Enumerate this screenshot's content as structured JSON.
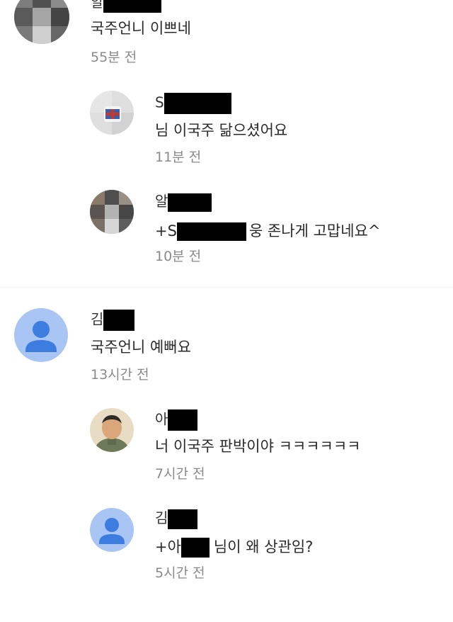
{
  "comments": [
    {
      "author_prefix": "알",
      "text": "국주언니 이쁘네",
      "time": "55분 전",
      "avatar": "user-photo-avatar",
      "replies": [
        {
          "author_prefix": "S",
          "text": "님 이국주 닮으셨어요",
          "time": "11분 전",
          "avatar": "cup-photo-avatar"
        },
        {
          "author_prefix": "알",
          "mention_prefix": "+S",
          "text": "웅 존나게 고맙네요^",
          "time": "10분 전",
          "avatar": "user-photo-avatar"
        }
      ]
    },
    {
      "author_prefix": "김",
      "text": "국주언니 예뻐요",
      "time": "13시간 전",
      "avatar": "default-person-avatar",
      "replies": [
        {
          "author_prefix": "아",
          "text": "너 이국주 판박이야 ㅋㅋㅋㅋㅋㅋ",
          "time": "7시간 전",
          "avatar": "portrait-photo-avatar"
        },
        {
          "author_prefix": "김",
          "mention_prefix": "+아",
          "text": "님이 왜 상관임?",
          "time": "5시간 전",
          "avatar": "default-person-avatar"
        }
      ]
    }
  ],
  "colors": {
    "default_avatar_bg": "#a8c5f4",
    "default_avatar_fg": "#3d7de0",
    "meta_text": "#8a8a8a"
  }
}
